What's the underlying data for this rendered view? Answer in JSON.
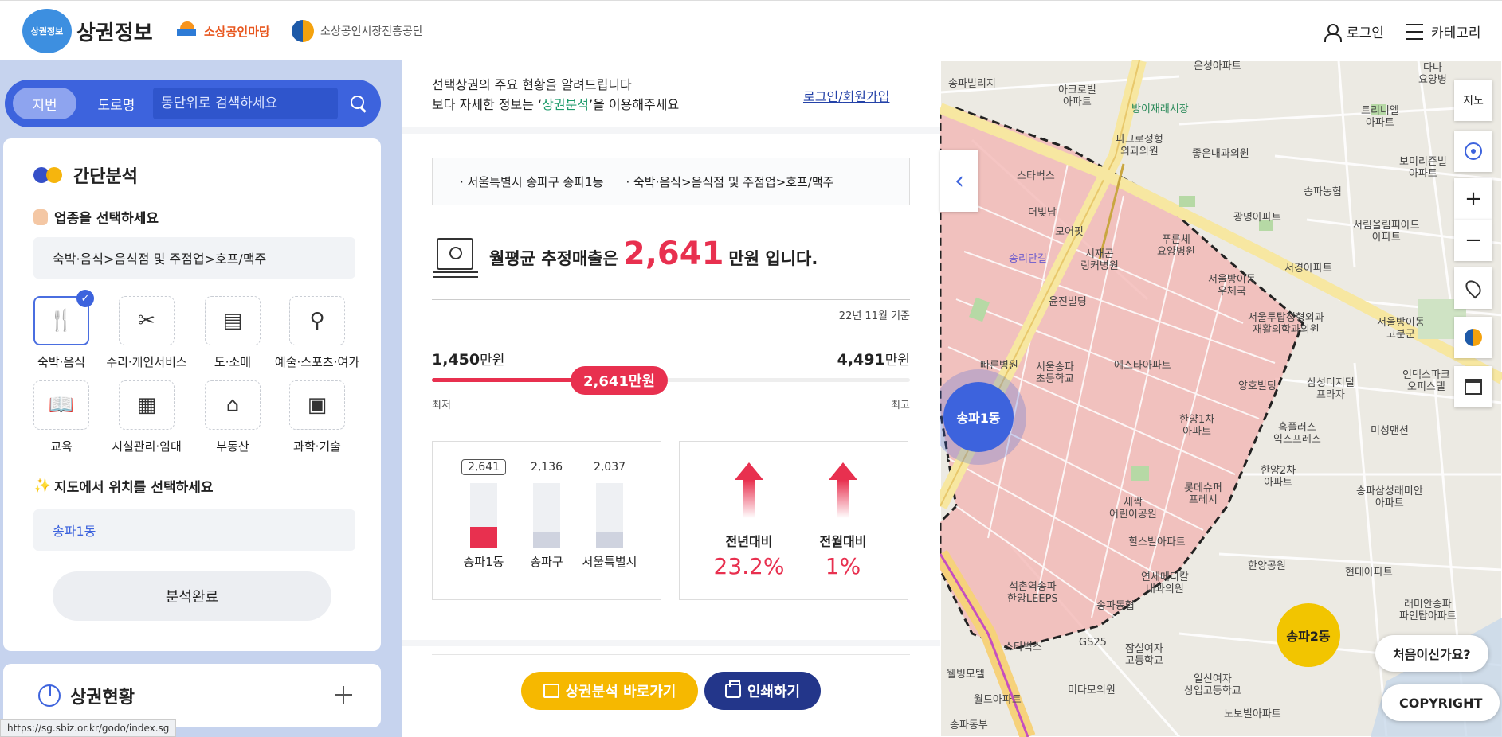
{
  "header": {
    "logo_badge": "상권정보",
    "logo_text": "상권정보",
    "partner1": "소상공인마당",
    "partner2": "소상공인시장진흥공단",
    "login": "로그인",
    "category": "카테고리"
  },
  "search": {
    "tab_jibun": "지번",
    "tab_road": "도로명",
    "placeholder": "동단위로 검색하세요"
  },
  "simple_analysis": {
    "title": "간단분석",
    "industry_label": "업종을 선택하세요",
    "industry_value": "숙박·음식>음식점 및 주점업>호프/맥주",
    "categories": [
      {
        "label": "숙박·음식",
        "icon": "fork-knife-icon",
        "glyph": "🍴",
        "selected": true
      },
      {
        "label": "수리·개인서비스",
        "icon": "tools-icon",
        "glyph": "✂"
      },
      {
        "label": "도·소매",
        "icon": "register-icon",
        "glyph": "▤"
      },
      {
        "label": "예술·스포츠·여가",
        "icon": "ping-pong-icon",
        "glyph": "⚲"
      },
      {
        "label": "교육",
        "icon": "book-icon",
        "glyph": "📖"
      },
      {
        "label": "시설관리·임대",
        "icon": "building-icon",
        "glyph": "▦"
      },
      {
        "label": "부동산",
        "icon": "house-search-icon",
        "glyph": "⌂"
      },
      {
        "label": "과학·기술",
        "icon": "computer-icon",
        "glyph": "▣"
      }
    ],
    "location_label": "지도에서 위치를 선택하세요",
    "location_value": "송파1동",
    "done_button": "분석완료"
  },
  "market_status": {
    "title": "상권현황"
  },
  "status_url": "https://sg.sbiz.or.kr/godo/index.sg",
  "info": {
    "line1": "선택상권의 주요 현황을 알려드립니다",
    "line2_pre": "보다 자세한 정보는 ‘",
    "line2_hl": "상권분석",
    "line2_post": "’을 이용해주세요",
    "login": "로그인",
    "slash": "/",
    "signup": "회원가입"
  },
  "tags": [
    "서울특별시 송파구 송파1동",
    "숙박·음식>음식점 및 주점업>호프/맥주"
  ],
  "revenue": {
    "prefix": "월평균 추정매출은",
    "value": "2,641",
    "suffix": "만원 입니다.",
    "as_of": "22년 11월 기준",
    "min_num": "1,450",
    "max_num": "4,491",
    "unit": "만원",
    "current_label": "2,641만원",
    "min_label": "최저",
    "max_label": "최고",
    "min_value": 1450,
    "max_value": 4491,
    "current_value": 2641
  },
  "chart_data": {
    "type": "bar",
    "categories": [
      "송파1동",
      "송파구",
      "서울특별시"
    ],
    "values": [
      2641,
      2136,
      2037
    ],
    "value_labels": [
      "2,641",
      "2,136",
      "2,037"
    ]
  },
  "comparison": [
    {
      "label": "전년대비",
      "value": "23.2%"
    },
    {
      "label": "전월대비",
      "value": "1%"
    }
  ],
  "buttons": {
    "analysis": "상권분석 바로가기",
    "print": "인쇄하기"
  },
  "map": {
    "controls": {
      "map_type": "지도"
    },
    "dong_main": "송파1동",
    "dong_other": "송파2동",
    "first_time": "처음이신가요?",
    "copyright": "COPYRIGHT",
    "labels": [
      {
        "text": "송파빌리지"
      },
      {
        "text": "아크로빌\n아파트"
      },
      {
        "text": "은성아파트"
      },
      {
        "text": "방이재래시장"
      },
      {
        "text": "파그로정형\n외과의원"
      },
      {
        "text": "좋은내과의원"
      },
      {
        "text": "스타벅스"
      },
      {
        "text": "더빛남"
      },
      {
        "text": "모어핏"
      },
      {
        "text": "송리단길"
      },
      {
        "text": "서재곤\n링커병원"
      },
      {
        "text": "푸른체\n요양병원"
      },
      {
        "text": "윤진빌딩"
      },
      {
        "text": "서울방이동\n우체국"
      },
      {
        "text": "서경아파트"
      },
      {
        "text": "빠른병원"
      },
      {
        "text": "서울송파\n초등학교"
      },
      {
        "text": "에스타아파트"
      },
      {
        "text": "서울투탑정형외과\n재활의학과의원"
      },
      {
        "text": "양호빌딩"
      },
      {
        "text": "삼성디지털\n프라자"
      },
      {
        "text": "한양1차\n아파트"
      },
      {
        "text": "홈플러스\n익스프레스"
      },
      {
        "text": "미성맨션"
      },
      {
        "text": "한양2차\n아파트"
      },
      {
        "text": "롯데슈퍼\n프레시"
      },
      {
        "text": "새싹\n어린이공원"
      },
      {
        "text": "송파삼성래미안\n아파트"
      },
      {
        "text": "힐스빌아파트"
      },
      {
        "text": "한양공원"
      },
      {
        "text": "현대아파트"
      },
      {
        "text": "연세메디칼\n내과의원"
      },
      {
        "text": "석촌역송파\n한양LEEPS"
      },
      {
        "text": "송파동협"
      },
      {
        "text": "GS25"
      },
      {
        "text": "잠실여자\n고등학교"
      },
      {
        "text": "일신여자\n상업고등학교"
      },
      {
        "text": "웰빙모텔"
      },
      {
        "text": "월드아파트"
      },
      {
        "text": "미다모의원"
      },
      {
        "text": "노보빌아파트"
      },
      {
        "text": "래미안송파\n파인탑아파트"
      },
      {
        "text": "송파동부"
      },
      {
        "text": "스타벅스"
      },
      {
        "text": "서울방이동\n고분군"
      },
      {
        "text": "인택스파크\n오피스텔"
      },
      {
        "text": "보미리즌빌\n아파트"
      },
      {
        "text": "서림올림피아드\n아파트"
      },
      {
        "text": "광명아파트"
      },
      {
        "text": "송파농협"
      },
      {
        "text": "트리니엘\n아파트"
      },
      {
        "text": "다나\n요양병"
      }
    ]
  }
}
